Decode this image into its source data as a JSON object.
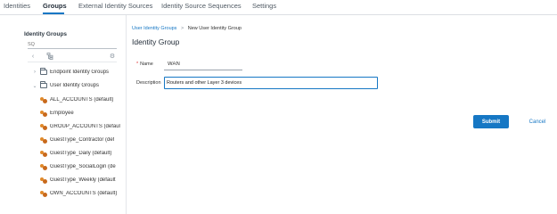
{
  "tabs": [
    {
      "label": "Identities"
    },
    {
      "label": "Groups"
    },
    {
      "label": "External Identity Sources"
    },
    {
      "label": "Identity Source Sequences"
    },
    {
      "label": "Settings"
    }
  ],
  "active_tab": "Groups",
  "left_panel": {
    "title": "Identity Groups",
    "search": {
      "value": "",
      "placeholder": "SQ"
    },
    "tree": {
      "folders": [
        {
          "label": "Endpoint Identity Groups",
          "expanded": false
        },
        {
          "label": "User Identity Groups",
          "expanded": true
        }
      ],
      "items": [
        {
          "label": "ALL_ACCOUNTS (default)"
        },
        {
          "label": "Employee"
        },
        {
          "label": "GROUP_ACCOUNTS (default"
        },
        {
          "label": "GuestType_Contractor (def"
        },
        {
          "label": "GuestType_Daily (default)"
        },
        {
          "label": "GuestType_SocialLogin (de"
        },
        {
          "label": "GuestType_Weekly (default"
        },
        {
          "label": "OWN_ACCOUNTS (default)"
        }
      ]
    }
  },
  "breadcrumb": {
    "link": "User Identity Groups",
    "separator": ">",
    "current": "New User Identity Group"
  },
  "page_title": "Identity Group",
  "form": {
    "name_label": "Name",
    "required_mark": "*",
    "name_value": "WAN",
    "description_label": "Description",
    "description_value": "Routers and other Layer 3 devices"
  },
  "actions": {
    "submit_label": "Submit",
    "cancel_label": "Cancel"
  },
  "colors": {
    "accent": "#1677c4",
    "group_icon": "#e08a2a"
  },
  "icons": {
    "collapse": "chevron-left-icon",
    "tree_view": "tree-icon",
    "settings": "gear-icon",
    "folder": "folder-icon",
    "group": "user-group-icon"
  }
}
